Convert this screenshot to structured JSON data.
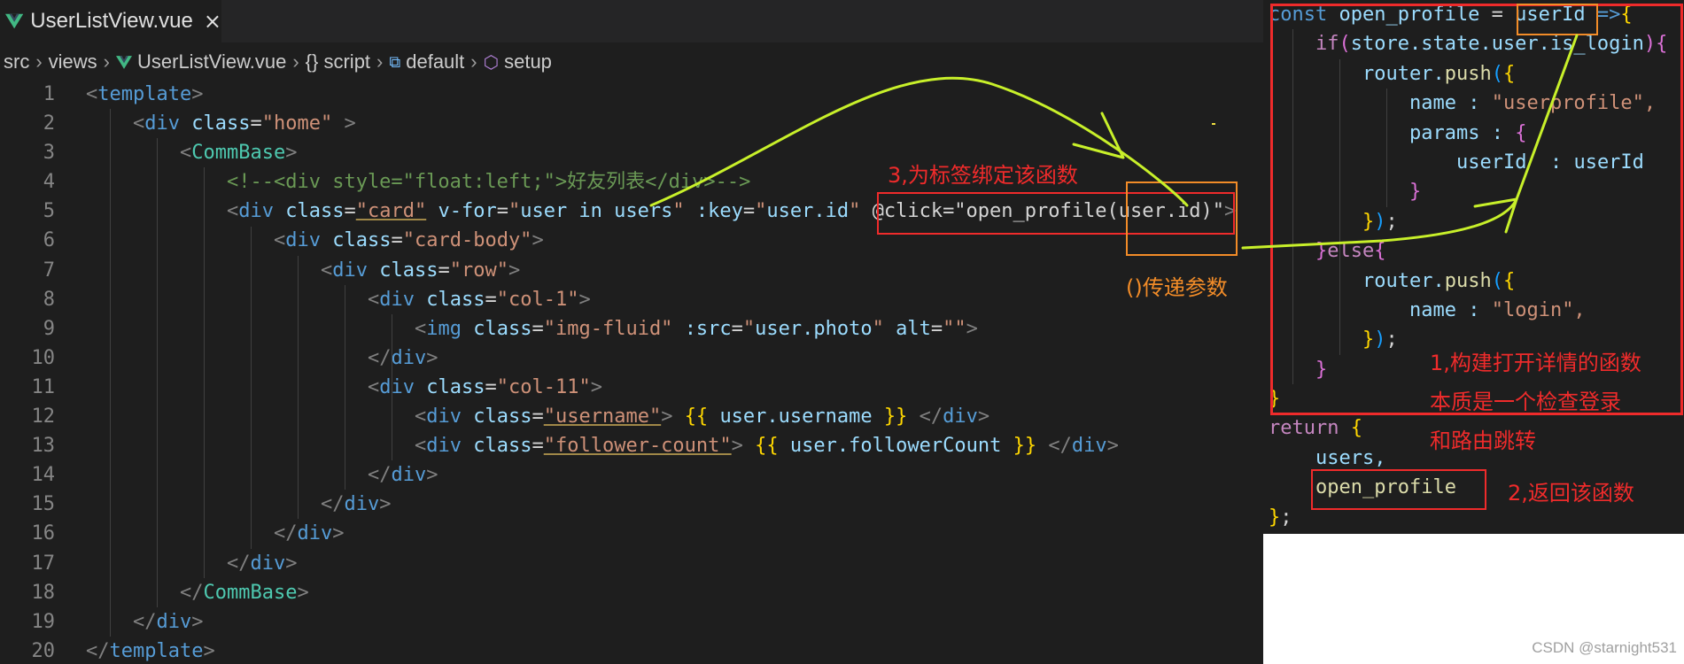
{
  "tab": {
    "title": "UserListView.vue",
    "close": "×"
  },
  "breadcrumb": [
    "src",
    "views",
    "UserListView.vue",
    "{} script",
    "default",
    "setup"
  ],
  "line_numbers": [
    "1",
    "2",
    "3",
    "4",
    "5",
    "6",
    "7",
    "8",
    "9",
    "10",
    "11",
    "12",
    "13",
    "14",
    "15",
    "16",
    "17",
    "18",
    "19",
    "20"
  ],
  "template_code": [
    [
      "<",
      "template",
      ">"
    ],
    [
      "<",
      "div",
      "class",
      "=",
      "\"home\"",
      ">"
    ],
    [
      "<",
      "CommBase",
      ">"
    ],
    [
      "<!--<div style=\"float:left;\">好友列表</div>-->"
    ],
    [
      "<",
      "div",
      "class",
      "=",
      "\"card\"",
      "v-for",
      "=",
      "\"",
      "user in users",
      "\"",
      ":key",
      "=",
      "\"",
      "user.id",
      "\"",
      "@click=\"open_profile(user.id)\"",
      ">"
    ],
    [
      "<",
      "div",
      "class",
      "=",
      "\"card-body\"",
      ">"
    ],
    [
      "<",
      "div",
      "class",
      "=",
      "\"row\"",
      ">"
    ],
    [
      "<",
      "div",
      "class",
      "=",
      "\"col-1\"",
      ">"
    ],
    [
      "<",
      "img",
      "class",
      "=",
      "\"img-fluid\"",
      ":src",
      "=",
      "\"",
      "user.photo",
      "\"",
      "alt",
      "=",
      "\"\"",
      ">"
    ],
    [
      "</",
      "div",
      ">"
    ],
    [
      "<",
      "div",
      "class",
      "=",
      "\"col-11\"",
      ">"
    ],
    [
      "<",
      "div",
      "class",
      "=",
      "\"username\"",
      ">",
      "{{",
      "user.username",
      "}}",
      "</",
      "div",
      ">"
    ],
    [
      "<",
      "div",
      "class",
      "=",
      "\"follower-count\"",
      ">",
      "{{",
      "user.followerCount",
      "}}",
      "</",
      "div",
      ">"
    ],
    [
      "</",
      "div",
      ">"
    ],
    [
      "</",
      "div",
      ">"
    ],
    [
      "</",
      "div",
      ">"
    ],
    [
      "</",
      "div",
      ">"
    ],
    [
      "</",
      "CommBase",
      ">"
    ],
    [
      "</",
      "div",
      ">"
    ],
    [
      "</",
      "template",
      ">"
    ]
  ],
  "script_code": [
    "const open_profile = userId =>{",
    "if(store.state.user.is_login){",
    "router.push({",
    "name : \"userprofile\",",
    "params : {",
    "userId  : userId",
    "}",
    "});",
    "}else{",
    "router.push({",
    "name : \"login\",",
    "});",
    "}",
    "}",
    "return {",
    "users,",
    "open_profile",
    "};"
  ],
  "annotations": {
    "step3": "3,为标签绑定该函数",
    "param": "()传递参数",
    "step1_line1": "1,构建打开详情的函数",
    "step1_line2": "本质是一个检查登录",
    "step1_line3": "和路由跳转",
    "step2": "2,返回该函数"
  },
  "watermark": "CSDN @starnight531",
  "colors": {
    "editor_bg": "#1e1e1e",
    "annotation_red": "#ef2b2b",
    "annotation_orange": "#f28c28",
    "arrow_yellow": "#c8f02a"
  }
}
